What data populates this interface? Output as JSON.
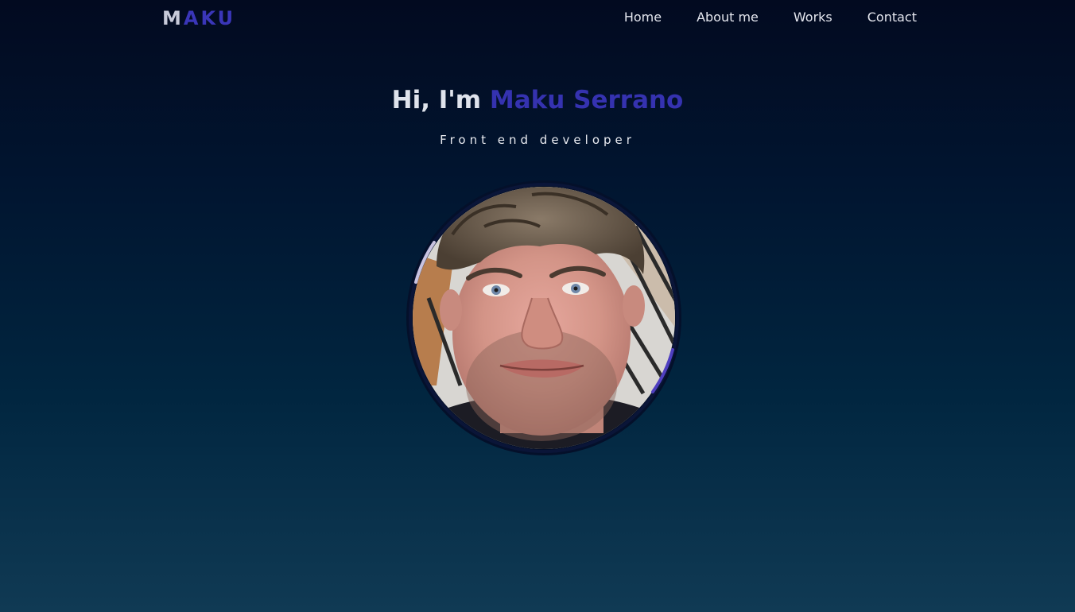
{
  "navbar": {
    "logo": {
      "first_letter": "M",
      "rest": "AKU"
    },
    "links": [
      {
        "label": "Home"
      },
      {
        "label": "About me"
      },
      {
        "label": "Works"
      },
      {
        "label": "Contact"
      }
    ]
  },
  "hero": {
    "greeting": "Hi, I'm",
    "name": "Maku Serrano",
    "subtitle": "Front end developer"
  },
  "colors": {
    "accent": "#3532b0",
    "accent_ring": "#4f3fc0",
    "light_ring": "#c9c3e0",
    "background_top": "#020a20",
    "background_bottom": "#103a54",
    "text": "#e8eaf0"
  },
  "icons": {
    "avatar": "profile-photo"
  }
}
